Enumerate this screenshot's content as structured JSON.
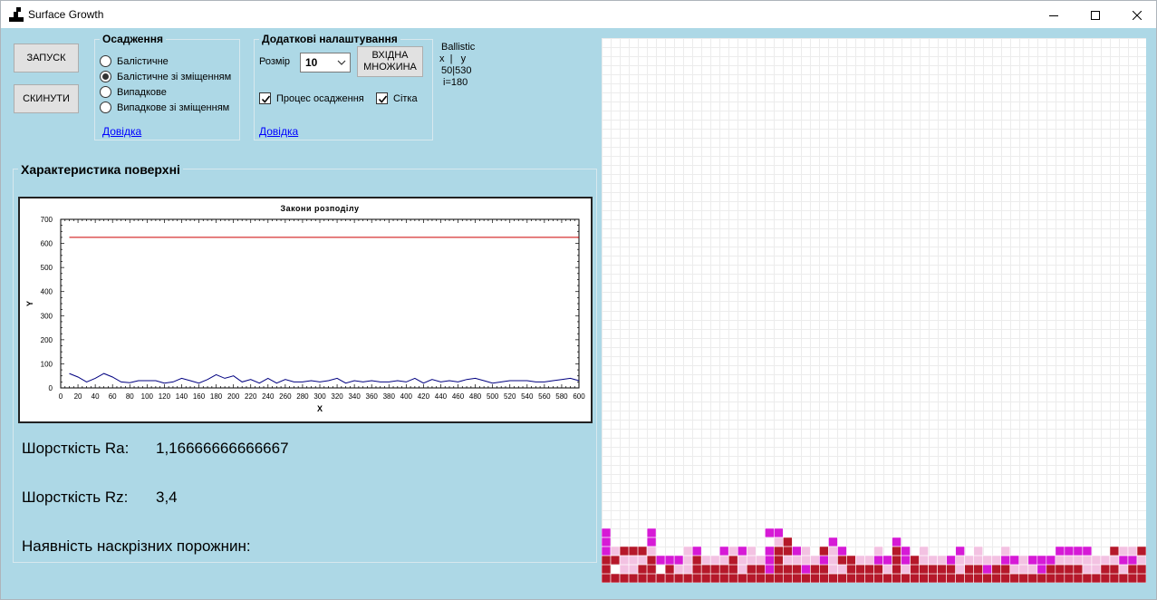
{
  "window": {
    "title": "Surface Growth"
  },
  "buttons": {
    "start": "ЗАПУСК",
    "reset": "СКИНУТИ"
  },
  "deposition": {
    "title": "Осадження",
    "options": [
      {
        "label": "Балістичне",
        "checked": false
      },
      {
        "label": "Балістичне зі зміщенням",
        "checked": true
      },
      {
        "label": "Випадкове",
        "checked": false
      },
      {
        "label": "Випадкове зі зміщенням",
        "checked": false
      }
    ],
    "help": "Довідка"
  },
  "settings": {
    "title": "Додаткові налаштування",
    "size_label": "Розмір",
    "size_value": "10",
    "input_set_button": "ВХІДНА МНОЖИНА",
    "show_process_label": "Процес осадження",
    "show_process_checked": true,
    "grid_label": "Сітка",
    "grid_checked": true,
    "help": "Довідка"
  },
  "info": {
    "mode": "Ballistic",
    "xy_header": "x  |   y",
    "xy_value": "50|530",
    "iteration": "i=180"
  },
  "surface": {
    "title": "Характеристика поверхні",
    "roughness_ra_label": "Шорсткість Ra:",
    "roughness_ra_value": "1,16666666666667",
    "roughness_rz_label": "Шорсткість Rz:",
    "roughness_rz_value": "3,4",
    "voids_label": "Наявність наскрізних порожнин:"
  },
  "chart_data": {
    "type": "line",
    "title": "Закони розподілу",
    "xlabel": "X",
    "ylabel": "Y",
    "xlim": [
      0,
      600
    ],
    "ylim": [
      0,
      700
    ],
    "x_ticks": [
      0,
      20,
      40,
      60,
      80,
      100,
      120,
      140,
      160,
      180,
      200,
      220,
      240,
      260,
      280,
      300,
      320,
      340,
      360,
      380,
      400,
      420,
      440,
      460,
      480,
      500,
      520,
      540,
      560,
      580,
      600
    ],
    "y_ticks": [
      0,
      100,
      200,
      300,
      400,
      500,
      600,
      700
    ],
    "series": [
      {
        "color": "#cc0000",
        "x": [
          10,
          600
        ],
        "y": [
          625,
          625
        ]
      },
      {
        "color": "#000080",
        "x": [
          10,
          20,
          30,
          40,
          50,
          60,
          70,
          80,
          90,
          100,
          110,
          120,
          130,
          140,
          150,
          160,
          170,
          180,
          190,
          200,
          210,
          220,
          230,
          240,
          250,
          260,
          270,
          280,
          290,
          300,
          310,
          320,
          330,
          340,
          350,
          360,
          370,
          380,
          390,
          400,
          410,
          420,
          430,
          440,
          450,
          460,
          470,
          480,
          490,
          500,
          510,
          520,
          530,
          540,
          550,
          560,
          570,
          580,
          590,
          600
        ],
        "y": [
          60,
          45,
          25,
          40,
          60,
          45,
          25,
          22,
          30,
          30,
          30,
          20,
          25,
          40,
          30,
          20,
          35,
          55,
          40,
          50,
          25,
          35,
          20,
          40,
          20,
          35,
          25,
          25,
          30,
          25,
          30,
          40,
          20,
          30,
          25,
          30,
          25,
          25,
          30,
          25,
          40,
          20,
          35,
          25,
          30,
          25,
          35,
          40,
          30,
          20,
          25,
          30,
          30,
          30,
          25,
          25,
          30,
          35,
          40,
          30
        ]
      }
    ]
  },
  "grid": {
    "cols": 60,
    "rows": 60,
    "colors": [
      "#ffffff",
      "#d61ad6",
      "#f3c2e2",
      "#b5182a"
    ],
    "layers_bottom_up": [
      "3333333333333333333333333333333333333333333333333333333333333",
      "3022330322333332331333133223333232333332331332221333322332333",
      "3322231112322232221322221233221131322212222211211122222221122",
      "1233320002100121201331203210002031020001020020000011110032233",
      "1000010000000000000230000100000010000000000000000000000000000",
      "1000010000000000001100000000000000000000000000000000000000000"
    ]
  }
}
